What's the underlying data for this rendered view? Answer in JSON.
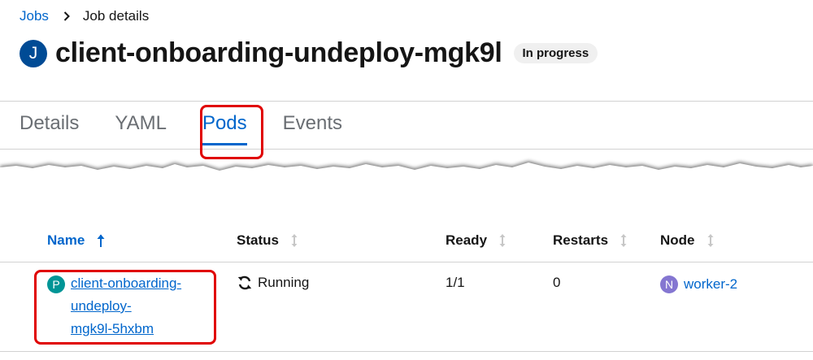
{
  "breadcrumb": {
    "parent": "Jobs",
    "current": "Job details"
  },
  "header": {
    "badge_letter": "J",
    "title": "client-onboarding-undeploy-mgk9l",
    "status": "In progress",
    "badge_color": "#004b95"
  },
  "tabs": [
    {
      "label": "Details"
    },
    {
      "label": "YAML"
    },
    {
      "label": "Pods"
    },
    {
      "label": "Events"
    }
  ],
  "active_tab": "Pods",
  "table": {
    "columns": [
      "Name",
      "Status",
      "Ready",
      "Restarts",
      "Node"
    ],
    "sorted_column": "Name",
    "rows": [
      {
        "badge_letter": "P",
        "badge_color": "#009596",
        "name": "client-onboarding-undeploy-mgk9l-5hxbm",
        "name_lines": [
          "client-onboarding-",
          "undeploy-",
          "mgk9l-5hxbm"
        ],
        "status": "Running",
        "ready": "1/1",
        "restarts": "0",
        "node_badge": "N",
        "node_badge_color": "#8476d1",
        "node": "worker-2"
      }
    ]
  },
  "colors": {
    "link": "#0066cc",
    "highlight": "#e00000"
  }
}
